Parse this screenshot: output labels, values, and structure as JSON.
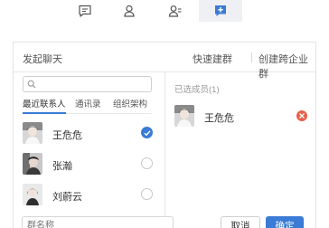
{
  "colors": {
    "accent": "#3a7bd5",
    "remove": "#e8604c",
    "border": "#e3e3e3"
  },
  "toolbar": {
    "items": [
      {
        "icon": "chat-bubble-icon"
      },
      {
        "icon": "contacts-icon"
      },
      {
        "icon": "group-contacts-icon"
      },
      {
        "icon": "add-chat-icon",
        "active": true
      }
    ]
  },
  "panel": {
    "title": "发起聊天",
    "quick_group": "快速建群",
    "cross_org_group": "创建跨企业群"
  },
  "search": {
    "placeholder": "",
    "value": ""
  },
  "tabs": [
    "最近联系人",
    "通讯录",
    "组织架构"
  ],
  "contacts": [
    {
      "name": "王危危",
      "selected": true
    },
    {
      "name": "张瀚",
      "selected": false
    },
    {
      "name": "刘蔚云",
      "selected": false
    }
  ],
  "selected": {
    "label": "已选成员(1)",
    "members": [
      {
        "name": "王危危"
      }
    ]
  },
  "group_name": {
    "placeholder": "群名称",
    "value": ""
  },
  "buttons": {
    "cancel": "取消",
    "confirm": "确定"
  }
}
